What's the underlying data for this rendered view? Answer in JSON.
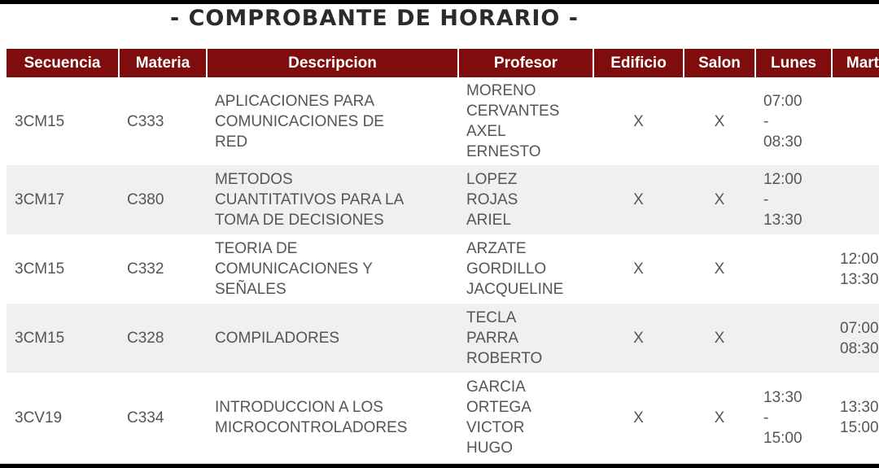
{
  "page": {
    "title": "- COMPROBANTE DE HORARIO -"
  },
  "colors": {
    "header_bg": "#7f0d0d",
    "header_text": "#ffffff",
    "row_alt_bg": "#f0f0f0",
    "text": "#555555"
  },
  "table": {
    "headers": {
      "secuencia": "Secuencia",
      "materia": "Materia",
      "descripcion": "Descripcion",
      "profesor": "Profesor",
      "edificio": "Edificio",
      "salon": "Salon",
      "lunes": "Lunes",
      "martes": "Martes"
    },
    "rows": [
      {
        "secuencia": "3CM15",
        "materia": "C333",
        "descripcion": [
          "APLICACIONES PARA",
          "COMUNICACIONES DE",
          "RED"
        ],
        "profesor": [
          "MORENO",
          "CERVANTES",
          "AXEL",
          "ERNESTO"
        ],
        "edificio": "X",
        "salon": "X",
        "lunes": [
          "07:00",
          "-",
          "08:30"
        ],
        "martes": []
      },
      {
        "secuencia": "3CM17",
        "materia": "C380",
        "descripcion": [
          "METODOS",
          "CUANTITATIVOS PARA LA",
          "TOMA DE DECISIONES"
        ],
        "profesor": [
          "LOPEZ",
          "ROJAS",
          "ARIEL"
        ],
        "edificio": "X",
        "salon": "X",
        "lunes": [
          "12:00",
          "-",
          "13:30"
        ],
        "martes": []
      },
      {
        "secuencia": "3CM15",
        "materia": "C332",
        "descripcion": [
          "TEORIA DE",
          "COMUNICACIONES Y",
          "SEÑALES"
        ],
        "profesor": [
          "ARZATE",
          "GORDILLO",
          "JACQUELINE"
        ],
        "edificio": "X",
        "salon": "X",
        "lunes": [],
        "martes": [
          "12:00",
          "13:30"
        ]
      },
      {
        "secuencia": "3CM15",
        "materia": "C328",
        "descripcion": [
          "COMPILADORES"
        ],
        "profesor": [
          "TECLA",
          "PARRA",
          "ROBERTO"
        ],
        "edificio": "X",
        "salon": "X",
        "lunes": [],
        "martes": [
          "07:00",
          "08:30"
        ]
      },
      {
        "secuencia": "3CV19",
        "materia": "C334",
        "descripcion": [
          "INTRODUCCION A LOS",
          "MICROCONTROLADORES"
        ],
        "profesor": [
          "GARCIA",
          "ORTEGA",
          "VICTOR",
          "HUGO"
        ],
        "edificio": "X",
        "salon": "X",
        "lunes": [
          "13:30",
          "-",
          "15:00"
        ],
        "martes": [
          "13:30",
          "15:00"
        ]
      }
    ]
  }
}
